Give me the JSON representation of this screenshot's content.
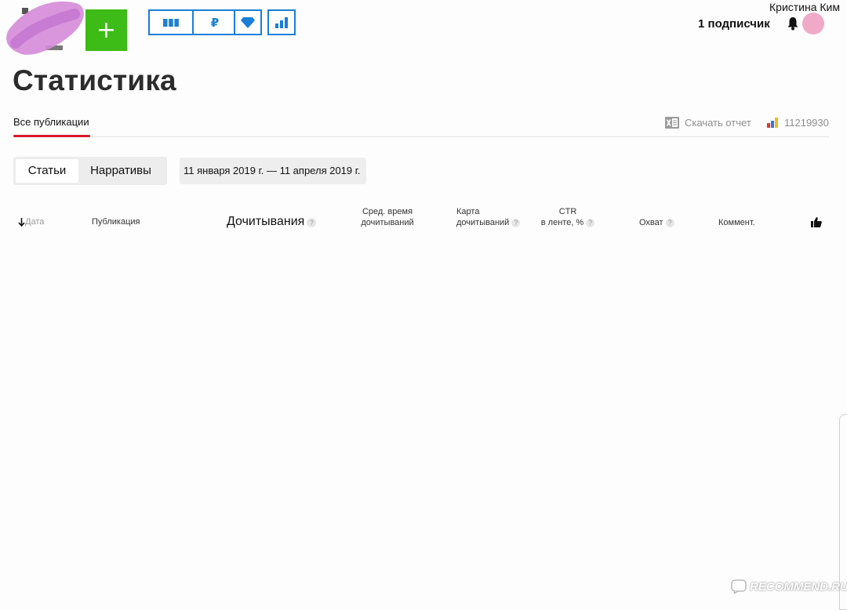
{
  "header": {
    "add_label": "+",
    "tools": [
      {
        "icon": "columns-icon"
      },
      {
        "icon": "ruble-icon",
        "label": "₽"
      },
      {
        "icon": "diamond-icon"
      },
      {
        "icon": "bar-chart-icon"
      }
    ],
    "subscribers": "1 подписчик",
    "username": "Кристина Ким",
    "accent_color": "#1a7fd6",
    "add_color": "#3dbb16"
  },
  "page": {
    "title": "Статистика",
    "tab_all": "Все публикации",
    "download": "Скачать отчет",
    "metrika_id": "11219930",
    "underline_color": "#d9182b"
  },
  "filters": {
    "segment_active": "Статьи",
    "segment_other": "Нарративы",
    "daterange": "11 января 2019 г. — 11 апреля 2019 г."
  },
  "table": {
    "col_date": "Дата",
    "col_pub": "Публикация",
    "col_reads": "Дочитывания",
    "col_avgtime_1": "Сред. время",
    "col_avgtime_2": "дочитываний",
    "col_map_1": "Карта",
    "col_map_2": "дочитываний",
    "col_ctr_1": "CTR",
    "col_ctr_2": "в ленте, %",
    "col_reach": "Охват",
    "col_comments": "Коммент.",
    "help": "?"
  },
  "watermark": {
    "text": "RECOMMEND.RU"
  }
}
